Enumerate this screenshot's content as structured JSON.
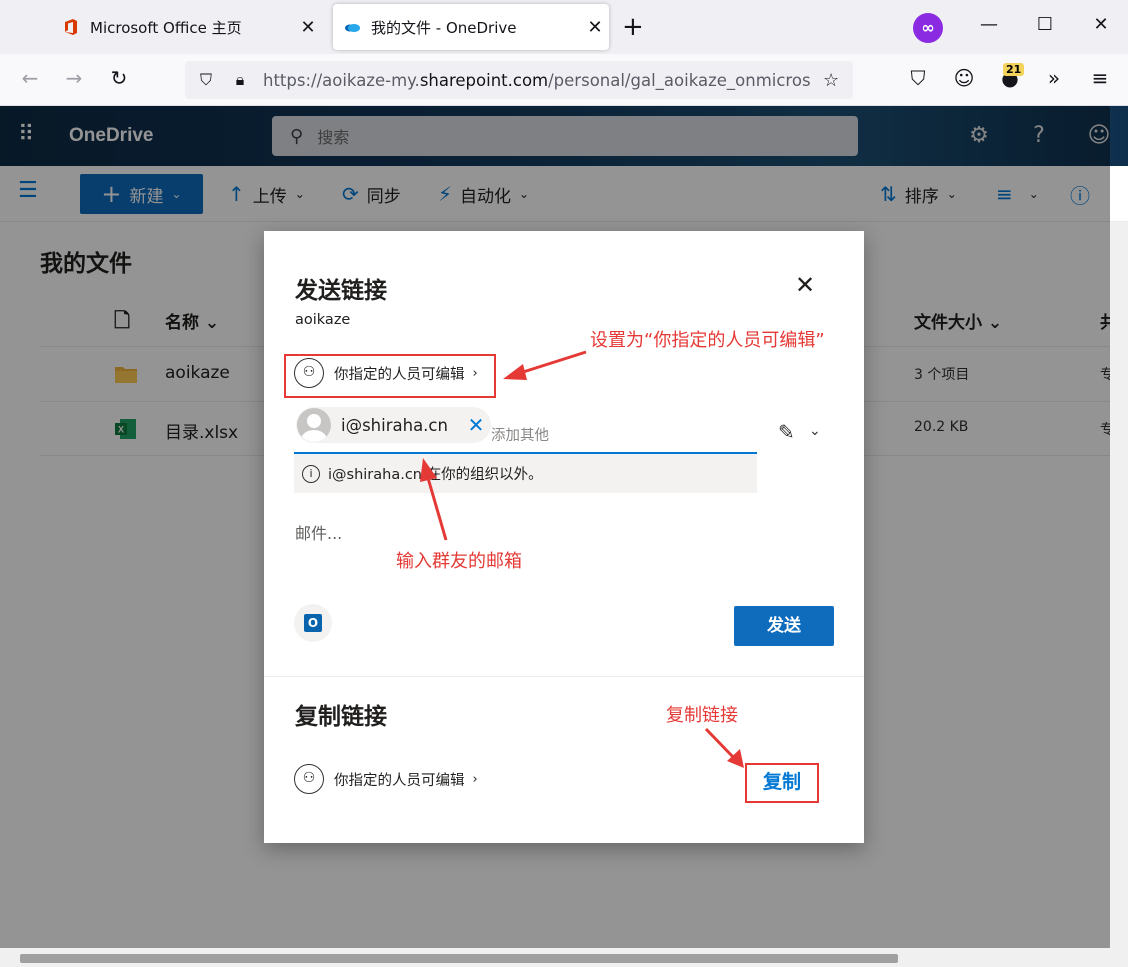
{
  "browser": {
    "tabs": [
      {
        "title": "Microsoft Office 主页",
        "active": false
      },
      {
        "title": "我的文件 - OneDrive",
        "active": true
      }
    ],
    "url_prefix": "https://aoikaze-my.",
    "url_domain": "sharepoint.com",
    "url_suffix": "/personal/gal_aoikaze_onmicros",
    "extension_badge_count": "21"
  },
  "app": {
    "brand": "OneDrive",
    "search_placeholder": "搜索"
  },
  "commands": {
    "new": "新建",
    "upload": "上传",
    "sync": "同步",
    "automate": "自动化",
    "sort": "排序"
  },
  "files": {
    "page_title": "我的文件",
    "columns": {
      "name": "名称",
      "size": "文件大小"
    },
    "rows": [
      {
        "name": "aoikaze",
        "type": "folder",
        "size": "3 个项目",
        "share": "专"
      },
      {
        "name": "目录.xlsx",
        "type": "excel",
        "size": "20.2 KB",
        "share": "专"
      }
    ]
  },
  "dialog": {
    "title": "发送链接",
    "file_name": "aoikaze",
    "permission": "你指定的人员可编辑",
    "recipient": "i@shiraha.cn",
    "add_others_placeholder": "添加其他",
    "info_text": "i@shiraha.cn 在你的组织以外。",
    "message_placeholder": "邮件...",
    "send_label": "发送",
    "copy_title": "复制链接",
    "copy_permission": "你指定的人员可编辑",
    "copy_label": "复制"
  },
  "annotations": {
    "set_permission": "设置为“你指定的人员可编辑”",
    "enter_email": "输入群友的邮箱",
    "copy_link": "复制链接"
  },
  "colors": {
    "accent": "#0f6cbd",
    "annotation": "#e53935"
  }
}
